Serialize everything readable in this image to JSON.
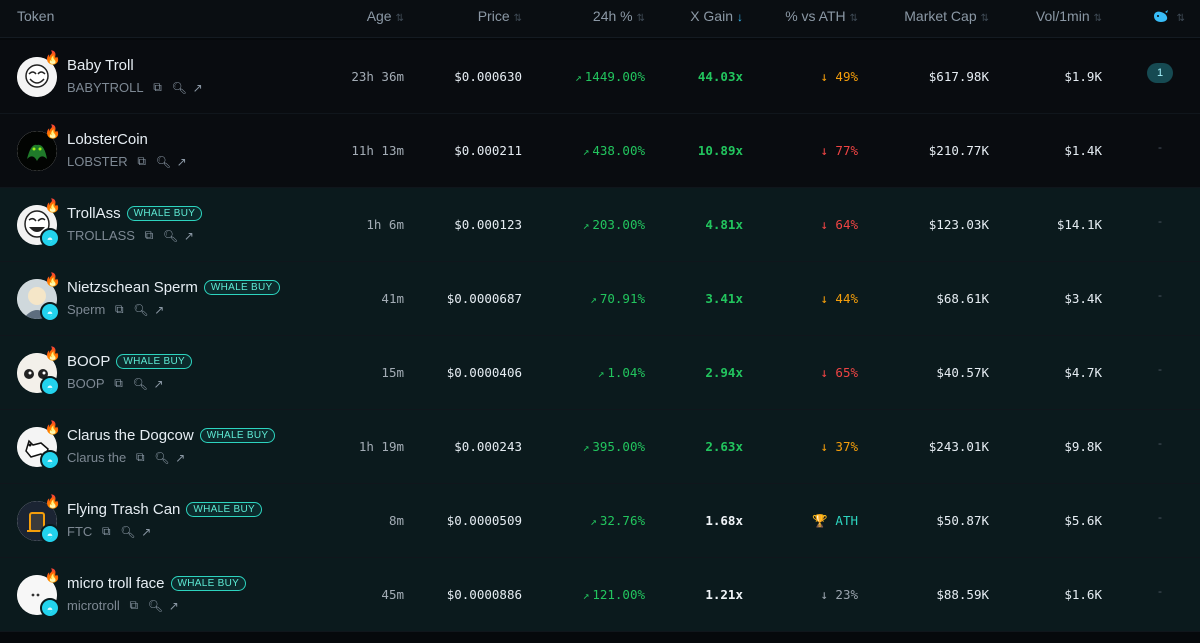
{
  "header": {
    "token": "Token",
    "age": "Age",
    "price": "Price",
    "change": "24h %",
    "xgain": "X Gain",
    "vs_ath": "% vs ATH",
    "mcap": "Market Cap",
    "vol": "Vol/1min",
    "sort_icon": "⇅",
    "sort_active_icon": "↓",
    "last_col_icon": "whale-icon"
  },
  "rows": [
    {
      "name": "Baby Troll",
      "symbol": "BABYTROLL",
      "badge": "",
      "age": "23h 36m",
      "price": "$0.000630",
      "change": "1449.00%",
      "xgain": "44.03x",
      "ath": "49%",
      "ath_arrow": "↓",
      "mcap": "$617.98K",
      "vol": "$1.9K",
      "last": "1"
    },
    {
      "name": "LobsterCoin",
      "symbol": "LOBSTER",
      "badge": "",
      "age": "11h 13m",
      "price": "$0.000211",
      "change": "438.00%",
      "xgain": "10.89x",
      "ath": "77%",
      "ath_arrow": "↓",
      "mcap": "$210.77K",
      "vol": "$1.4K",
      "last": "-"
    },
    {
      "name": "TrollAss",
      "symbol": "TROLLASS",
      "badge": "WHALE BUY",
      "age": "1h 6m",
      "price": "$0.000123",
      "change": "203.00%",
      "xgain": "4.81x",
      "ath": "64%",
      "ath_arrow": "↓",
      "mcap": "$123.03K",
      "vol": "$14.1K",
      "last": "-"
    },
    {
      "name": "Nietzschean Sperm",
      "symbol": "Sperm",
      "badge": "WHALE BUY",
      "age": "41m",
      "price": "$0.0000687",
      "change": "70.91%",
      "xgain": "3.41x",
      "ath": "44%",
      "ath_arrow": "↓",
      "mcap": "$68.61K",
      "vol": "$3.4K",
      "last": "-"
    },
    {
      "name": "BOOP",
      "symbol": "BOOP",
      "badge": "WHALE BUY",
      "age": "15m",
      "price": "$0.0000406",
      "change": "1.04%",
      "xgain": "2.94x",
      "ath": "65%",
      "ath_arrow": "↓",
      "mcap": "$40.57K",
      "vol": "$4.7K",
      "last": "-"
    },
    {
      "name": "Clarus the Dogcow",
      "symbol": "Clarus the",
      "badge": "WHALE BUY",
      "age": "1h 19m",
      "price": "$0.000243",
      "change": "395.00%",
      "xgain": "2.63x",
      "ath": "37%",
      "ath_arrow": "↓",
      "mcap": "$243.01K",
      "vol": "$9.8K",
      "last": "-"
    },
    {
      "name": "Flying Trash Can",
      "symbol": "FTC",
      "badge": "WHALE BUY",
      "age": "8m",
      "price": "$0.0000509",
      "change": "32.76%",
      "xgain": "1.68x",
      "ath": "ATH",
      "ath_arrow": "🏆",
      "mcap": "$50.87K",
      "vol": "$5.6K",
      "last": "-"
    },
    {
      "name": "micro troll face",
      "symbol": "microtroll",
      "badge": "WHALE BUY",
      "age": "45m",
      "price": "$0.0000886",
      "change": "121.00%",
      "xgain": "1.21x",
      "ath": "23%",
      "ath_arrow": "↓",
      "mcap": "$88.59K",
      "vol": "$1.6K",
      "last": "-"
    }
  ],
  "colors": {
    "accent": "#22d3ee",
    "positive": "#22c55e",
    "negative": "#ef4444",
    "warning": "#f59e0b",
    "badge": "#2dd4bf"
  }
}
